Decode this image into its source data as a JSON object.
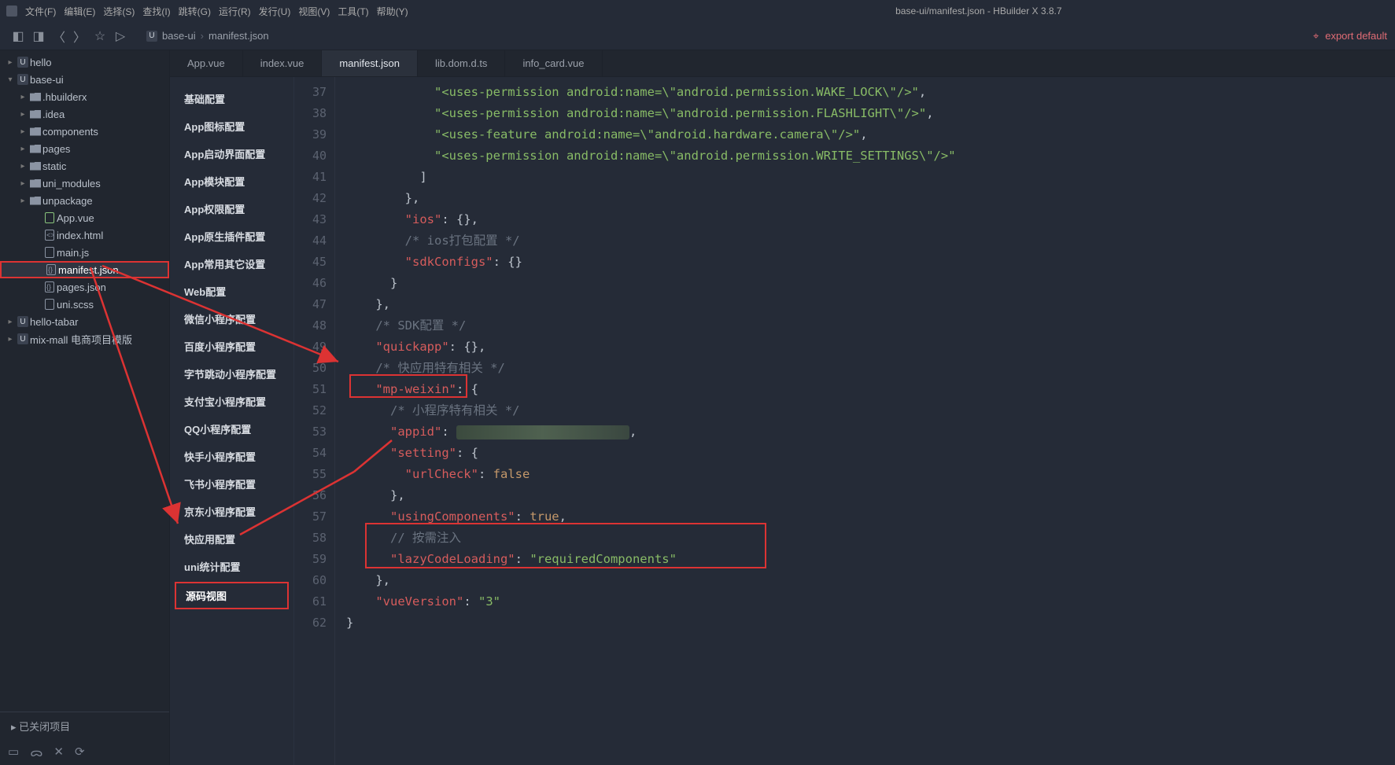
{
  "window": {
    "title": "base-ui/manifest.json - HBuilder X 3.8.7"
  },
  "menubar": [
    "文件(F)",
    "编辑(E)",
    "选择(S)",
    "查找(I)",
    "跳转(G)",
    "运行(R)",
    "发行(U)",
    "视图(V)",
    "工具(T)",
    "帮助(Y)"
  ],
  "toolbar": {
    "export_label": "export default"
  },
  "breadcrumb": {
    "a": "base-ui",
    "b": "manifest.json"
  },
  "tree": {
    "nodes": [
      {
        "type": "proj",
        "label": "hello",
        "expanded": false
      },
      {
        "type": "proj",
        "label": "base-ui",
        "expanded": true,
        "children": [
          {
            "type": "folder",
            "label": ".hbuilderx"
          },
          {
            "type": "folder",
            "label": ".idea"
          },
          {
            "type": "folder",
            "label": "components"
          },
          {
            "type": "folder",
            "label": "pages"
          },
          {
            "type": "folder",
            "label": "static"
          },
          {
            "type": "folder",
            "label": "uni_modules"
          },
          {
            "type": "folder",
            "label": "unpackage"
          },
          {
            "type": "file",
            "label": "App.vue",
            "icon": "vue"
          },
          {
            "type": "file",
            "label": "index.html",
            "icon": "html"
          },
          {
            "type": "file",
            "label": "main.js",
            "icon": "js"
          },
          {
            "type": "file",
            "label": "manifest.json",
            "icon": "json",
            "active": true,
            "boxed": true
          },
          {
            "type": "file",
            "label": "pages.json",
            "icon": "json"
          },
          {
            "type": "file",
            "label": "uni.scss",
            "icon": "scss"
          }
        ]
      },
      {
        "type": "proj",
        "label": "hello-tabar",
        "expanded": false
      },
      {
        "type": "proj",
        "label": "mix-mall 电商项目模版",
        "expanded": false
      }
    ],
    "closed": "已关闭项目"
  },
  "tabs": [
    {
      "label": "App.vue"
    },
    {
      "label": "index.vue"
    },
    {
      "label": "manifest.json",
      "active": true
    },
    {
      "label": "lib.dom.d.ts"
    },
    {
      "label": "info_card.vue"
    }
  ],
  "configNav": [
    "基础配置",
    "App图标配置",
    "App启动界面配置",
    "App模块配置",
    "App权限配置",
    "App原生插件配置",
    "App常用其它设置",
    "Web配置",
    "微信小程序配置",
    "百度小程序配置",
    "字节跳动小程序配置",
    "支付宝小程序配置",
    "QQ小程序配置",
    "快手小程序配置",
    "飞书小程序配置",
    "京东小程序配置",
    "快应用配置",
    "uni统计配置"
  ],
  "configNavActive": "源码视图",
  "code": {
    "start": 37,
    "lines": [
      {
        "n": 37,
        "html": "            <span class='tok-str'>\"&lt;uses-permission android:name=\\\"android.permission.WAKE_LOCK\\\"/&gt;\"</span><span class='tok-punc'>,</span>"
      },
      {
        "n": 38,
        "html": "            <span class='tok-str'>\"&lt;uses-permission android:name=\\\"android.permission.FLASHLIGHT\\\"/&gt;\"</span><span class='tok-punc'>,</span>"
      },
      {
        "n": 39,
        "html": "            <span class='tok-str'>\"&lt;uses-feature android:name=\\\"android.hardware.camera\\\"/&gt;\"</span><span class='tok-punc'>,</span>"
      },
      {
        "n": 40,
        "html": "            <span class='tok-str'>\"&lt;uses-permission android:name=\\\"android.permission.WRITE_SETTINGS\\\"/&gt;\"</span>"
      },
      {
        "n": 41,
        "html": "          <span class='tok-punc'>]</span>"
      },
      {
        "n": 42,
        "html": "        <span class='tok-punc'>},</span>"
      },
      {
        "n": 43,
        "html": "        <span class='tok-key'>\"ios\"</span><span class='tok-punc'>: {},</span>"
      },
      {
        "n": 44,
        "html": "        <span class='tok-cmt'>/* ios打包配置 */</span>"
      },
      {
        "n": 45,
        "html": "        <span class='tok-key'>\"sdkConfigs\"</span><span class='tok-punc'>: {}</span>"
      },
      {
        "n": 46,
        "html": "      <span class='tok-punc'>}</span>"
      },
      {
        "n": 47,
        "html": "    <span class='tok-punc'>},</span>"
      },
      {
        "n": 48,
        "html": "    <span class='tok-cmt'>/* SDK配置 */</span>"
      },
      {
        "n": 49,
        "html": "    <span class='tok-key'>\"quickapp\"</span><span class='tok-punc'>: {},</span>"
      },
      {
        "n": 50,
        "html": "    <span class='tok-cmt'>/* 快应用特有相关 */</span>"
      },
      {
        "n": 51,
        "html": "    <span class='tok-key'>\"mp-weixin\"</span><span class='tok-punc'>: {</span>"
      },
      {
        "n": 52,
        "html": "      <span class='tok-cmt'>/* 小程序特有相关 */</span>"
      },
      {
        "n": 53,
        "html": "      <span class='tok-key'>\"appid\"</span><span class='tok-punc'>: </span><span class='smudge'></span><span class='tok-punc'>,</span>"
      },
      {
        "n": 54,
        "html": "      <span class='tok-key'>\"setting\"</span><span class='tok-punc'>: {</span>"
      },
      {
        "n": 55,
        "html": "        <span class='tok-key'>\"urlCheck\"</span><span class='tok-punc'>: </span><span class='tok-bool'>false</span>"
      },
      {
        "n": 56,
        "html": "      <span class='tok-punc'>},</span>"
      },
      {
        "n": 57,
        "html": "      <span class='tok-key'>\"usingComponents\"</span><span class='tok-punc'>: </span><span class='tok-bool'>true</span><span class='tok-punc'>,</span>"
      },
      {
        "n": 58,
        "html": "      <span class='tok-cmt'>// 按需注入</span>"
      },
      {
        "n": 59,
        "html": "      <span class='tok-key'>\"lazyCodeLoading\"</span><span class='tok-punc'>: </span><span class='tok-str'>\"requiredComponents\"</span>"
      },
      {
        "n": 60,
        "html": "    <span class='tok-punc'>},</span>"
      },
      {
        "n": 61,
        "html": "    <span class='tok-key'>\"vueVersion\"</span><span class='tok-punc'>: </span><span class='tok-str'>\"3\"</span>"
      },
      {
        "n": 62,
        "html": "<span class='tok-punc'>}</span>"
      }
    ]
  },
  "chart_data": {
    "type": "table",
    "title": "manifest.json fragment (lines 37–62)",
    "json_content": {
      "ios": {},
      "sdkConfigs": {},
      "quickapp": {},
      "mp-weixin": {
        "appid": "(redacted)",
        "setting": {
          "urlCheck": false
        },
        "usingComponents": true,
        "lazyCodeLoading": "requiredComponents"
      },
      "vueVersion": "3"
    },
    "android_permissions_tail": [
      "<uses-permission android:name=\"android.permission.WAKE_LOCK\"/>",
      "<uses-permission android:name=\"android.permission.FLASHLIGHT\"/>",
      "<uses-feature android:name=\"android.hardware.camera\"/>",
      "<uses-permission android:name=\"android.permission.WRITE_SETTINGS\"/>"
    ]
  }
}
